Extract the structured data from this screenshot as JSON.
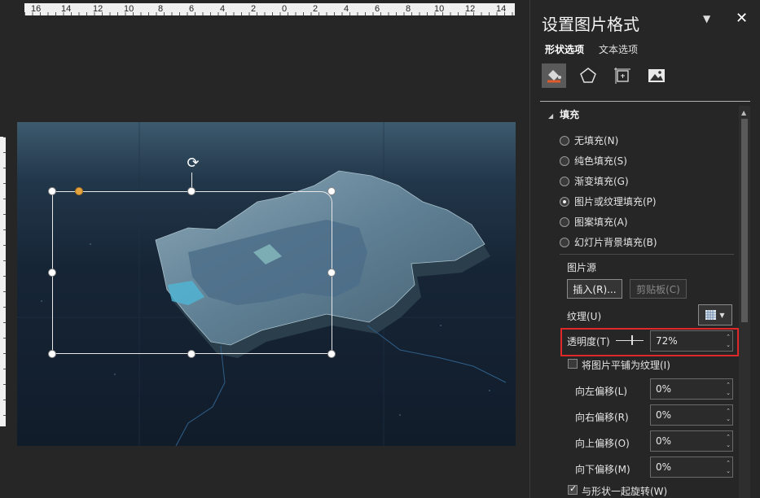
{
  "ruler": {
    "numbers": [
      "16",
      "14",
      "12",
      "10",
      "8",
      "6",
      "4",
      "2",
      "0",
      "2",
      "4",
      "6",
      "8",
      "10",
      "12",
      "14"
    ]
  },
  "pane": {
    "title": "设置图片格式",
    "menu_icon": "chevron-down-icon",
    "close_label": "✕",
    "tabs": [
      {
        "label": "形状选项",
        "active": true
      },
      {
        "label": "文本选项",
        "active": false
      }
    ],
    "icons": [
      "fill-line-icon",
      "effects-pentagon-icon",
      "size-properties-icon",
      "picture-icon"
    ],
    "fill_section": {
      "header": "填充",
      "options": [
        {
          "label": "无填充(N)",
          "checked": false
        },
        {
          "label": "纯色填充(S)",
          "checked": false
        },
        {
          "label": "渐变填充(G)",
          "checked": false
        },
        {
          "label": "图片或纹理填充(P)",
          "checked": true
        },
        {
          "label": "图案填充(A)",
          "checked": false
        },
        {
          "label": "幻灯片背景填充(B)",
          "checked": false
        }
      ],
      "picture_source_label": "图片源",
      "insert_button": "插入(R)...",
      "clipboard_button": "剪贴板(C)",
      "texture_label": "纹理(U)",
      "transparency_label": "透明度(T)",
      "transparency_value": "72%",
      "tile_label": "将图片平铺为纹理(I)",
      "tile_checked": false,
      "offsets": [
        {
          "label": "向左偏移(L)",
          "value": "0%"
        },
        {
          "label": "向右偏移(R)",
          "value": "0%"
        },
        {
          "label": "向上偏移(O)",
          "value": "0%"
        },
        {
          "label": "向下偏移(M)",
          "value": "0%"
        }
      ],
      "rotate_label": "与形状一起旋转(W)",
      "rotate_checked": true
    }
  },
  "colors": {
    "highlight": "#e02828",
    "handle_accent": "#e6a23c",
    "map_fill": "#6f8fa3"
  }
}
